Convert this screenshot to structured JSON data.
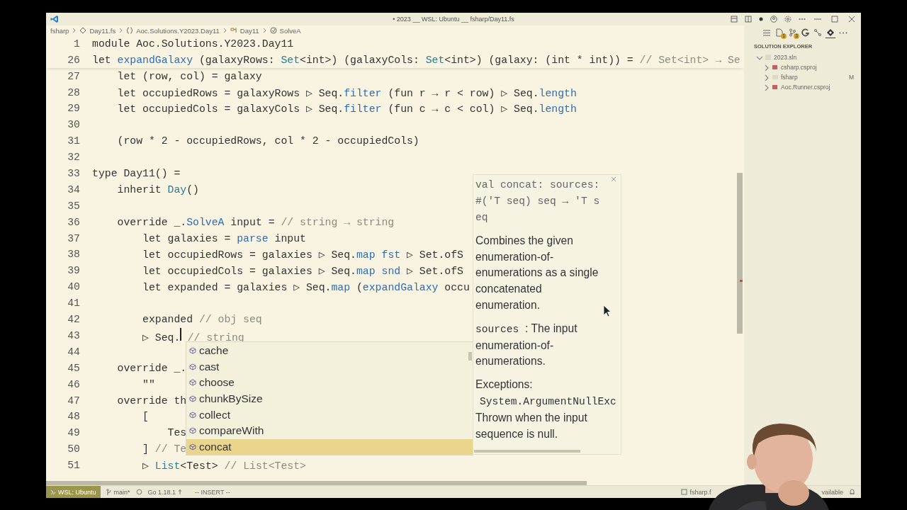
{
  "window": {
    "title": "• 2023 __ WSL: Ubuntu __ fsharp/Day11.fs"
  },
  "breadcrumbs": [
    {
      "kind": "folder",
      "label": "fsharp"
    },
    {
      "kind": "file",
      "label": "Day11.fs"
    },
    {
      "kind": "namespace",
      "label": "Aoc.Solutions.Y2023.Day11"
    },
    {
      "kind": "class",
      "label": "Day11"
    },
    {
      "kind": "method",
      "label": "SolveA"
    }
  ],
  "editor": {
    "lines": [
      {
        "number": "1",
        "tokens": [
          {
            "kind": "plain",
            "text": "module Aoc.Solutions.Y2023.Day11"
          }
        ]
      },
      {
        "number": "26",
        "tokens": [
          {
            "kind": "plain",
            "text": "let "
          },
          {
            "kind": "fn",
            "text": "expandGalaxy"
          },
          {
            "kind": "plain",
            "text": " (galaxyRows: "
          },
          {
            "kind": "type",
            "text": "Set"
          },
          {
            "kind": "plain",
            "text": "<int>) (galaxyCols: "
          },
          {
            "kind": "type",
            "text": "Set"
          },
          {
            "kind": "plain",
            "text": "<int>) (galaxy: (int * int)) = "
          },
          {
            "kind": "comment",
            "text": "// Set<int> → Se"
          }
        ]
      },
      {
        "number": "27",
        "tokens": [
          {
            "kind": "plain",
            "text": "    let (row, col) = galaxy"
          }
        ]
      },
      {
        "number": "28",
        "tokens": [
          {
            "kind": "plain",
            "text": "    let occupiedRows = galaxyRows ▷ Seq."
          },
          {
            "kind": "fn",
            "text": "filter"
          },
          {
            "kind": "plain",
            "text": " (fun r → r < row) ▷ Seq."
          },
          {
            "kind": "fn",
            "text": "length"
          }
        ]
      },
      {
        "number": "29",
        "tokens": [
          {
            "kind": "plain",
            "text": "    let occupiedCols = galaxyCols ▷ Seq."
          },
          {
            "kind": "fn",
            "text": "filter"
          },
          {
            "kind": "plain",
            "text": " (fun c → c < col) ▷ Seq."
          },
          {
            "kind": "fn",
            "text": "length"
          }
        ]
      },
      {
        "number": "30"
      },
      {
        "number": "31",
        "tokens": [
          {
            "kind": "plain",
            "text": "    (row * 2 - occupiedRows, col * 2 - occupiedCols)"
          }
        ]
      },
      {
        "number": "32"
      },
      {
        "number": "33",
        "tokens": [
          {
            "kind": "plain",
            "text": "type Day11() ="
          }
        ]
      },
      {
        "number": "34",
        "tokens": [
          {
            "kind": "plain",
            "text": "    inherit "
          },
          {
            "kind": "type",
            "text": "Day"
          },
          {
            "kind": "plain",
            "text": "()"
          }
        ]
      },
      {
        "number": "35"
      },
      {
        "number": "36",
        "tokens": [
          {
            "kind": "plain",
            "text": "    override _."
          },
          {
            "kind": "fn",
            "text": "SolveA"
          },
          {
            "kind": "plain",
            "text": " input = "
          },
          {
            "kind": "comment",
            "text": "// string → string"
          }
        ]
      },
      {
        "number": "37",
        "tokens": [
          {
            "kind": "plain",
            "text": "        let galaxies = "
          },
          {
            "kind": "fn",
            "text": "parse"
          },
          {
            "kind": "plain",
            "text": " input"
          }
        ]
      },
      {
        "number": "38",
        "tokens": [
          {
            "kind": "plain",
            "text": "        let occupiedRows = galaxies ▷ Seq."
          },
          {
            "kind": "fn",
            "text": "map"
          },
          {
            "kind": "fn",
            "text": " fst"
          },
          {
            "kind": "plain",
            "text": " ▷ Set.ofS"
          }
        ]
      },
      {
        "number": "39",
        "tokens": [
          {
            "kind": "plain",
            "text": "        let occupiedCols = galaxies ▷ Seq."
          },
          {
            "kind": "fn",
            "text": "map"
          },
          {
            "kind": "fn",
            "text": " snd"
          },
          {
            "kind": "plain",
            "text": " ▷ Set.ofS"
          }
        ]
      },
      {
        "number": "40",
        "tokens": [
          {
            "kind": "plain",
            "text": "        let expanded = galaxies ▷ Seq."
          },
          {
            "kind": "fn",
            "text": "map"
          },
          {
            "kind": "plain",
            "text": " ("
          },
          {
            "kind": "fn",
            "text": "expandGalaxy"
          },
          {
            "kind": "plain",
            "text": " occu"
          }
        ]
      },
      {
        "number": "41"
      },
      {
        "number": "42",
        "tokens": [
          {
            "kind": "plain",
            "text": "        expanded "
          },
          {
            "kind": "comment",
            "text": "// obj seq"
          }
        ]
      },
      {
        "number": "43",
        "tokens": [
          {
            "kind": "plain",
            "text": "        ▷ Seq."
          },
          {
            "kind": "caret"
          },
          {
            "kind": "comment",
            "text": " // string"
          }
        ]
      },
      {
        "number": "44"
      },
      {
        "number": "45",
        "tokens": [
          {
            "kind": "plain",
            "text": "    override _."
          }
        ]
      },
      {
        "number": "46",
        "tokens": [
          {
            "kind": "plain",
            "text": "        \"\""
          }
        ]
      },
      {
        "number": "47",
        "tokens": [
          {
            "kind": "plain",
            "text": "    override th"
          }
        ]
      },
      {
        "number": "48",
        "tokens": [
          {
            "kind": "plain",
            "text": "        ["
          }
        ]
      },
      {
        "number": "49",
        "tokens": [
          {
            "kind": "plain",
            "text": "            Tes"
          }
        ]
      },
      {
        "number": "50",
        "tokens": [
          {
            "kind": "plain",
            "text": "        ] "
          },
          {
            "kind": "comment",
            "text": "// Te"
          }
        ]
      },
      {
        "number": "51",
        "tokens": [
          {
            "kind": "plain",
            "text": "        ▷ "
          },
          {
            "kind": "type",
            "text": "List"
          },
          {
            "kind": "plain",
            "text": "<Test> "
          },
          {
            "kind": "comment",
            "text": "// List<Test>"
          }
        ]
      }
    ]
  },
  "completion": {
    "items": [
      {
        "label": "cache",
        "selected": false
      },
      {
        "label": "cast",
        "selected": false
      },
      {
        "label": "choose",
        "selected": false
      },
      {
        "label": "chunkBySize",
        "selected": false
      },
      {
        "label": "collect",
        "selected": false
      },
      {
        "label": "compareWith",
        "selected": false
      },
      {
        "label": "concat",
        "selected": true
      }
    ]
  },
  "hover": {
    "signature": "val concat: sources: #('T seq) seq → 'T seq",
    "summary": "Combines the given enumeration-of-enumerations as a single concatenated enumeration.",
    "params": [
      {
        "name": "sources",
        "description": ": The input enumeration-of-enumerations."
      }
    ],
    "exceptions_heading": "Exceptions:",
    "exception_type": "System.ArgumentNullExc",
    "exception_text": "Thrown when the input sequence is null."
  },
  "sidebar": {
    "toolbar": [
      {
        "kind": "menu",
        "selected": false
      },
      {
        "kind": "files",
        "badge": "1",
        "selected": false
      },
      {
        "kind": "source-control",
        "badge": "3",
        "selected": false
      },
      {
        "kind": "g",
        "selected": false
      },
      {
        "kind": "graph",
        "selected": false
      },
      {
        "kind": "diamond",
        "selected": true
      },
      {
        "kind": "more",
        "selected": false
      }
    ],
    "title": "SOLUTION EXPLORER",
    "tree": [
      {
        "label": "2023.sln",
        "kind": "solution",
        "expanded": true,
        "children": [
          {
            "label": "csharp.csproj",
            "kind": "project",
            "expanded": false
          },
          {
            "label": "fsharp",
            "kind": "folder",
            "expanded": false,
            "badge": "M"
          },
          {
            "label": "Aoc.Runner.csproj",
            "kind": "project",
            "expanded": false
          }
        ]
      }
    ]
  },
  "status_bar": {
    "left": [
      {
        "kind": "remote",
        "label": "WSL: Ubuntu"
      },
      {
        "kind": "branch",
        "label": "main*"
      },
      {
        "kind": "sync"
      },
      {
        "kind": "go",
        "label": "Go 1.18.1"
      },
      {
        "kind": "mode",
        "label": "-- INSERT --"
      }
    ],
    "right": [
      {
        "kind": "file",
        "label": "fsharp.f"
      },
      {
        "kind": "gap"
      },
      {
        "kind": "text",
        "label": "vailable"
      },
      {
        "kind": "bell"
      }
    ]
  }
}
